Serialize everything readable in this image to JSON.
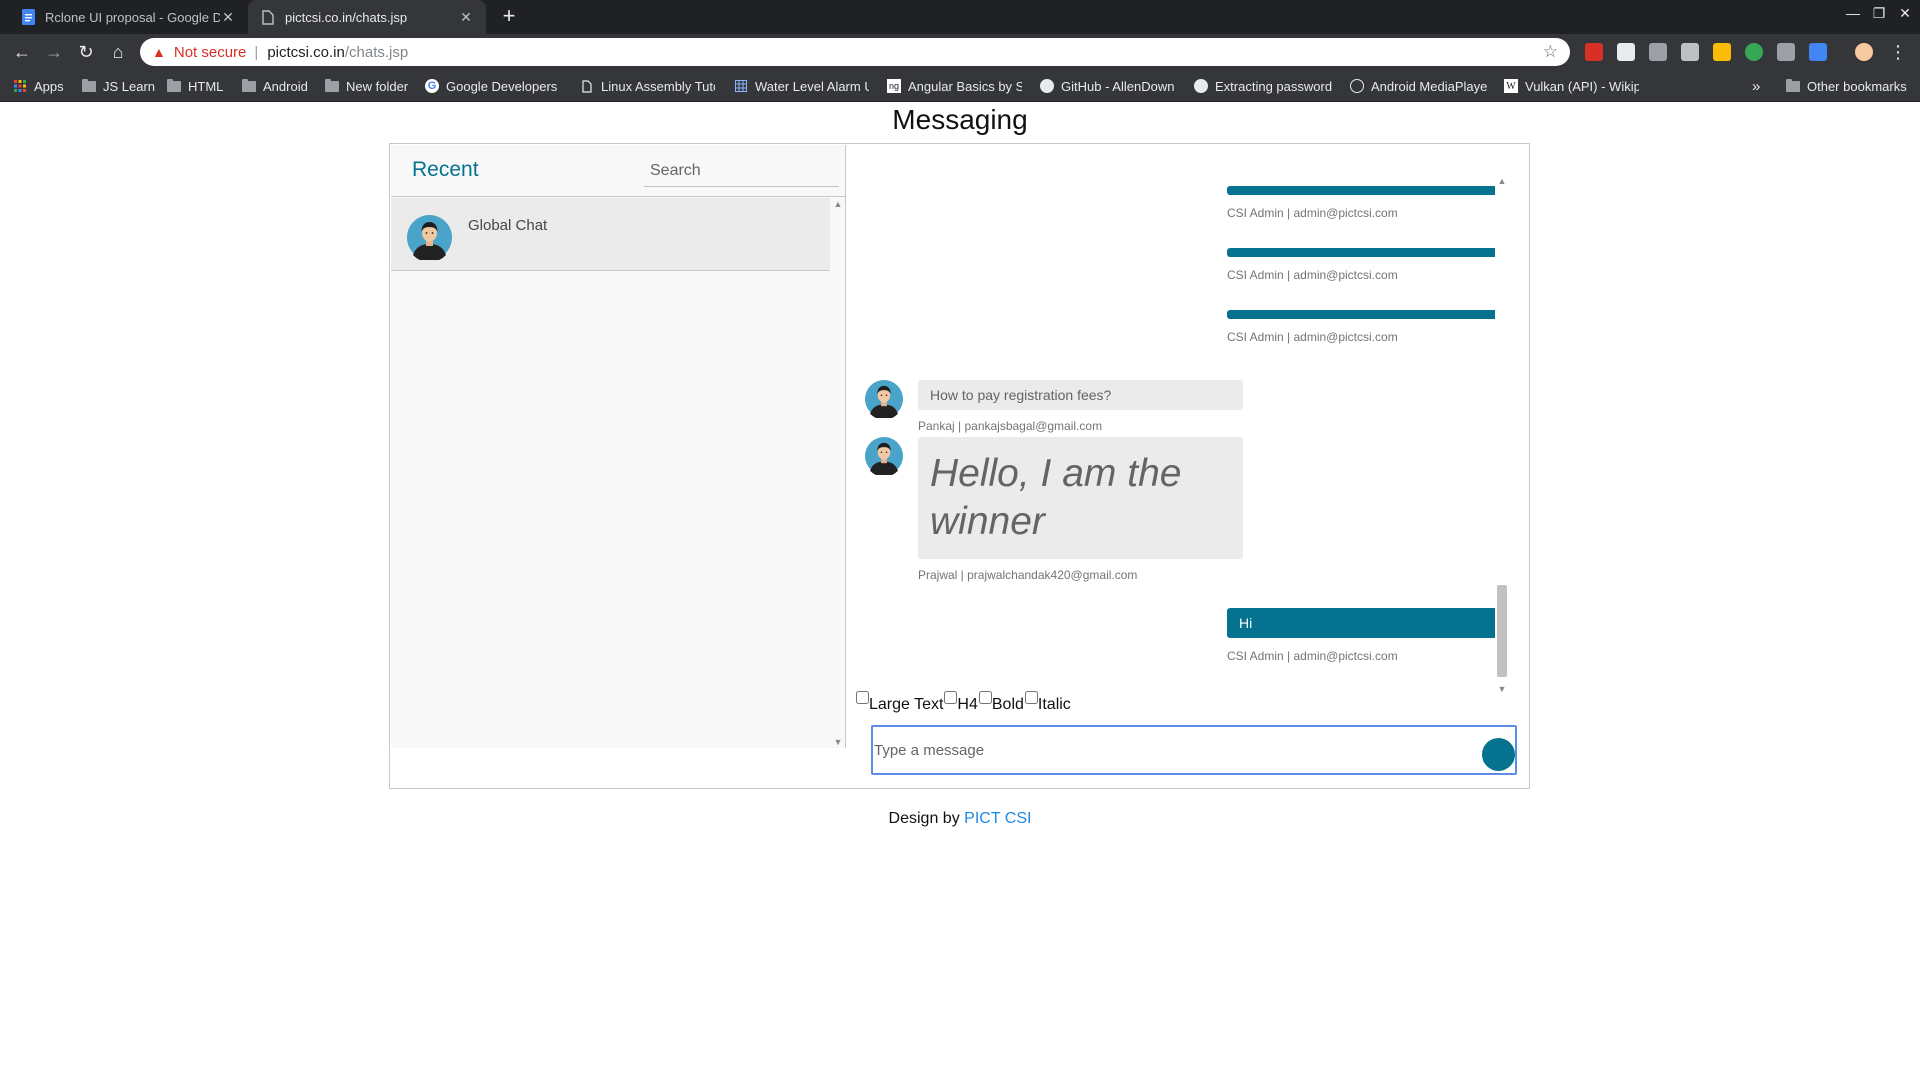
{
  "browser": {
    "tabs": [
      {
        "title": "Rclone UI proposal - Google Do",
        "active": false,
        "icon": "docs-icon"
      },
      {
        "title": "pictcsi.co.in/chats.jsp",
        "active": true,
        "icon": "page-icon"
      }
    ],
    "address": {
      "security_label": "Not secure",
      "host": "pictcsi.co.in",
      "path": "/chats.jsp"
    },
    "bookmarks": [
      {
        "label": "Apps",
        "icon": "apps-grid-icon"
      },
      {
        "label": "JS Learn",
        "icon": "folder-icon"
      },
      {
        "label": "HTML",
        "icon": "folder-icon"
      },
      {
        "label": "Android",
        "icon": "folder-icon"
      },
      {
        "label": "New folder",
        "icon": "folder-icon"
      },
      {
        "label": "Google Developers",
        "icon": "google-icon"
      },
      {
        "label": "Linux Assembly Tuto",
        "icon": "page-icon"
      },
      {
        "label": "Water Level Alarm U",
        "icon": "grid-icon"
      },
      {
        "label": "Angular Basics by S",
        "icon": "angular-icon"
      },
      {
        "label": "GitHub - AllenDown",
        "icon": "github-icon"
      },
      {
        "label": "Extracting passwords",
        "icon": "github-icon"
      },
      {
        "label": "Android MediaPlaye",
        "icon": "android-icon"
      },
      {
        "label": "Vulkan (API) - Wikipe",
        "icon": "wikipedia-icon"
      }
    ],
    "overflow_label": "»",
    "other_bookmarks": "Other bookmarks"
  },
  "page": {
    "title": "Messaging",
    "sidebar": {
      "heading": "Recent",
      "search_placeholder": "Search",
      "chats": [
        {
          "name": "Global Chat"
        }
      ]
    },
    "messages": [
      {
        "type": "outgoing",
        "text": "",
        "meta": "CSI Admin | admin@pictcsi.com"
      },
      {
        "type": "outgoing",
        "text": "",
        "meta": "CSI Admin | admin@pictcsi.com"
      },
      {
        "type": "outgoing",
        "text": "",
        "meta": "CSI Admin | admin@pictcsi.com"
      },
      {
        "type": "incoming",
        "text": "How to pay registration fees?",
        "meta": "Pankaj | pankajsbagal@gmail.com"
      },
      {
        "type": "incoming",
        "text": "Hello, I am the winner",
        "meta": "Prajwal | prajwalchandak420@gmail.com"
      },
      {
        "type": "outgoing",
        "text": "Hi",
        "meta": "CSI Admin | admin@pictcsi.com"
      }
    ],
    "format_options": [
      "Large Text",
      "H4",
      "Bold",
      "Italic"
    ],
    "composer": {
      "placeholder": "Type a message"
    },
    "footer": {
      "prefix": "Design by",
      "link": "PICT CSI"
    }
  },
  "colors": {
    "accent": "#05728f",
    "incoming_bubble": "#ebebeb",
    "chrome_dark": "#35363a",
    "link": "#1e88e5"
  }
}
